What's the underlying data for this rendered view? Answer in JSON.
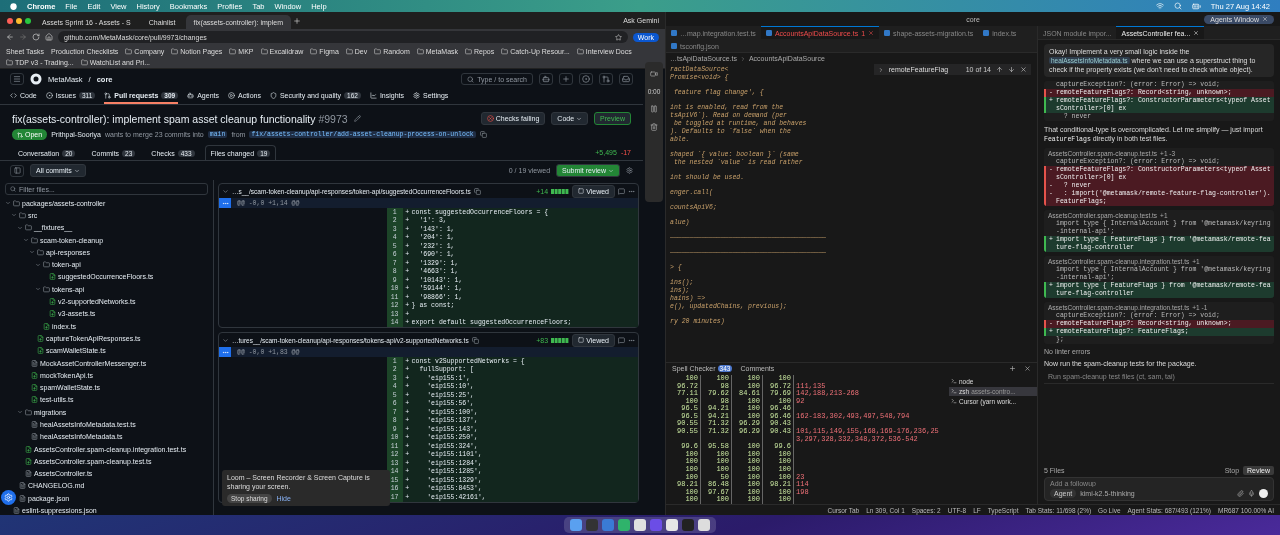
{
  "menubar": {
    "app": "Chrome",
    "items": [
      "File",
      "Edit",
      "View",
      "History",
      "Bookmarks",
      "Profiles",
      "Tab",
      "Window",
      "Help"
    ],
    "clock": "Thu 27 Aug  14:42"
  },
  "browser": {
    "tabs": [
      {
        "title": "Assets Sprint 16 - Assets - S",
        "selected": false
      },
      {
        "title": "Chainlist",
        "selected": false
      },
      {
        "title": "fix(assets-controller): implem",
        "selected": true
      }
    ],
    "ask": "Ask Gemini",
    "url": "github.com/MetaMask/core/pull/9973/changes",
    "profile": "Work",
    "bookmarks": [
      {
        "label": "Sheet Tasks",
        "kind": "link"
      },
      {
        "label": "Production Checklists",
        "kind": "link"
      },
      {
        "label": "Company",
        "kind": "folder"
      },
      {
        "label": "Notion Pages",
        "kind": "folder"
      },
      {
        "label": "MKP",
        "kind": "folder"
      },
      {
        "label": "Excalidraw",
        "kind": "folder"
      },
      {
        "label": "Figma",
        "kind": "folder"
      },
      {
        "label": "Dev",
        "kind": "folder"
      },
      {
        "label": "Random",
        "kind": "folder"
      },
      {
        "label": "MetaMask",
        "kind": "folder"
      },
      {
        "label": "Repos",
        "kind": "folder"
      },
      {
        "label": "Catch-Up Resour...",
        "kind": "folder"
      },
      {
        "label": "Interview Docs",
        "kind": "folder"
      },
      {
        "label": "TDP v3 - Trading...",
        "kind": "folder"
      },
      {
        "label": "WatchList and Pri...",
        "kind": "folder"
      }
    ],
    "owner": "MetaMask",
    "separator": "/",
    "repo": "core",
    "search": "Type / to search",
    "repo_nav": [
      {
        "label": "Code",
        "selected": false
      },
      {
        "label": "Issues",
        "count": "311",
        "selected": false
      },
      {
        "label": "Pull requests",
        "count": "309",
        "selected": true
      },
      {
        "label": "Agents",
        "selected": false
      },
      {
        "label": "Actions",
        "selected": false
      },
      {
        "label": "Security and quality",
        "count": "162",
        "selected": false
      },
      {
        "label": "Insights",
        "selected": false
      },
      {
        "label": "Settings",
        "selected": false
      }
    ],
    "pr": {
      "title": "fix(assets-controller): implement spam asset cleanup functionality",
      "number": "#9973",
      "checks": "Checks failing",
      "code": "Code",
      "preview": "Preview",
      "state": "Open",
      "author": "Prithpal-Sooriya",
      "merge_text": "wants to merge 23 commits into",
      "base": "main",
      "from": "from",
      "head": "fix/assets-controller/add-asset-cleanup-process-on-unlock",
      "tabs": [
        {
          "label": "Conversation",
          "count": "20",
          "selected": false
        },
        {
          "label": "Commits",
          "count": "23",
          "selected": false
        },
        {
          "label": "Checks",
          "count": "433",
          "selected": false
        },
        {
          "label": "Files changed",
          "count": "19",
          "selected": true
        }
      ],
      "additions": "+5,495",
      "deletions": "-17"
    },
    "review_bar": {
      "commits": "All commits",
      "viewed": "0 / 19 viewed",
      "submit": "Submit review"
    },
    "filter": "Filter files...",
    "tree": [
      {
        "name": "packages/assets-controller",
        "kind": "folder",
        "expanded": true,
        "children": [
          {
            "name": "src",
            "kind": "folder",
            "expanded": true,
            "children": [
              {
                "name": "__fixtures__",
                "kind": "folder",
                "expanded": true,
                "children": [
                  {
                    "name": "scam-token-cleanup",
                    "kind": "folder",
                    "expanded": true,
                    "children": [
                      {
                        "name": "api-responses",
                        "kind": "folder",
                        "expanded": true,
                        "children": [
                          {
                            "name": "token-api",
                            "kind": "folder",
                            "expanded": true,
                            "children": [
                              {
                                "name": "suggestedOccurrenceFloors.ts",
                                "kind": "added"
                              }
                            ]
                          },
                          {
                            "name": "tokens-api",
                            "kind": "folder",
                            "expanded": true,
                            "children": [
                              {
                                "name": "v2-supportedNetworks.ts",
                                "kind": "added"
                              },
                              {
                                "name": "v3-assets.ts",
                                "kind": "added"
                              }
                            ]
                          },
                          {
                            "name": "index.ts",
                            "kind": "added"
                          }
                        ]
                      },
                      {
                        "name": "captureTokenApiResponses.ts",
                        "kind": "added"
                      },
                      {
                        "name": "scamWalletState.ts",
                        "kind": "added"
                      }
                    ]
                  },
                  {
                    "name": "MockAssetControllerMessenger.ts",
                    "kind": "modified"
                  },
                  {
                    "name": "mockTokenApi.ts",
                    "kind": "added"
                  },
                  {
                    "name": "spamWalletState.ts",
                    "kind": "added"
                  },
                  {
                    "name": "test-utils.ts",
                    "kind": "added"
                  }
                ]
              },
              {
                "name": "migrations",
                "kind": "folder",
                "expanded": true,
                "children": [
                  {
                    "name": "healAssetsInfoMetadata.test.ts",
                    "kind": "modified"
                  },
                  {
                    "name": "healAssetsInfoMetadata.ts",
                    "kind": "modified"
                  }
                ]
              },
              {
                "name": "AssetsController.spam-cleanup.integration.test.ts",
                "kind": "added"
              },
              {
                "name": "AssetsController.spam-cleanup.test.ts",
                "kind": "added"
              },
              {
                "name": "AssetsController.ts",
                "kind": "modified"
              }
            ]
          },
          {
            "name": "CHANGELOG.md",
            "kind": "modified"
          },
          {
            "name": "package.json",
            "kind": "modified"
          }
        ]
      },
      {
        "name": "eslint-suppressions.json",
        "kind": "modified"
      }
    ],
    "diffs": [
      {
        "path": "…s__/scam-token-cleanup/api-responses/token-api/suggestedOccurrenceFloors.ts",
        "added": "+14",
        "hunk": "@@ -0,0 +1,14 @@",
        "viewed": "Viewed",
        "checked": false,
        "lines": [
          {
            "n": "1",
            "sign": "+",
            "code": "const suggestedOccurrenceFloors = {"
          },
          {
            "n": "2",
            "sign": "+",
            "code": "  '1': 3,"
          },
          {
            "n": "3",
            "sign": "+",
            "code": "  '143': 1,"
          },
          {
            "n": "4",
            "sign": "+",
            "code": "  '204': 1,"
          },
          {
            "n": "5",
            "sign": "+",
            "code": "  '232': 1,"
          },
          {
            "n": "6",
            "sign": "+",
            "code": "  '690': 1,"
          },
          {
            "n": "7",
            "sign": "+",
            "code": "  '1329': 1,"
          },
          {
            "n": "8",
            "sign": "+",
            "code": "  '4663': 1,"
          },
          {
            "n": "9",
            "sign": "+",
            "code": "  '10143': 1,"
          },
          {
            "n": "10",
            "sign": "+",
            "code": "  '59144': 1,"
          },
          {
            "n": "11",
            "sign": "+",
            "code": "  '98866': 1,"
          },
          {
            "n": "12",
            "sign": "+",
            "code": "} as const;"
          },
          {
            "n": "13",
            "sign": "+"
          },
          {
            "n": "14",
            "sign": "+",
            "code": "export default suggestedOccurrenceFloors;"
          }
        ]
      },
      {
        "path": "…tures__/scam-token-cleanup/api-responses/tokens-api/v2-supportedNetworks.ts",
        "added": "+83",
        "hunk": "@@ -0,0 +1,83 @@",
        "viewed": "Viewed",
        "checked": false,
        "lines": [
          {
            "n": "1",
            "sign": "+",
            "code": "const v2SupportedNetworks = {"
          },
          {
            "n": "2",
            "sign": "+",
            "code": "  fullSupport: ["
          },
          {
            "n": "3",
            "sign": "+",
            "code": "    'eip155:1',"
          },
          {
            "n": "4",
            "sign": "+",
            "code": "    'eip155:10',"
          },
          {
            "n": "5",
            "sign": "+",
            "code": "    'eip155:25',"
          },
          {
            "n": "6",
            "sign": "+",
            "code": "    'eip155:56',"
          },
          {
            "n": "7",
            "sign": "+",
            "code": "    'eip155:100',"
          },
          {
            "n": "8",
            "sign": "+",
            "code": "    'eip155:137',"
          },
          {
            "n": "9",
            "sign": "+",
            "code": "    'eip155:143',"
          },
          {
            "n": "10",
            "sign": "+",
            "code": "    'eip155:250',"
          },
          {
            "n": "11",
            "sign": "+",
            "code": "    'eip155:324',"
          },
          {
            "n": "12",
            "sign": "+",
            "code": "    'eip155:1101',"
          },
          {
            "n": "13",
            "sign": "+",
            "code": "    'eip155:1284',"
          },
          {
            "n": "14",
            "sign": "+",
            "code": "    'eip155:1285',"
          },
          {
            "n": "15",
            "sign": "+",
            "code": "    'eip155:1329',"
          },
          {
            "n": "16",
            "sign": "+",
            "code": "    'eip155:8453',"
          },
          {
            "n": "17",
            "sign": "+",
            "code": "    'eip155:42161',"
          }
        ]
      }
    ],
    "loom_timer": "0:00"
  },
  "editor": {
    "title": "core",
    "agents_button": "Agents Window",
    "tabs": [
      {
        "label": "…map.integration.test.ts",
        "selected": false
      },
      {
        "label": "AccountsApiDataSource.ts",
        "errors": "1",
        "selected": true
      },
      {
        "label": "shape-assets-migration.ts",
        "selected": false
      },
      {
        "label": "index.ts",
        "selected": false
      },
      {
        "label": "tsconfig.json",
        "selected": false
      }
    ],
    "breadcrumb": [
      "…tsApiDataSource.ts",
      "AccountsApiDataSource"
    ],
    "find": {
      "query": "remoteFeatureFlag",
      "count": "10 of 14"
    },
    "code_blocks": [
      [
        "ractDataSource<",
        "Promise<void> {"
      ],
      [
        " feature flag change', {"
      ],
      [
        "int is enabled, read from the",
        "tsApiV6`). Read on demand (per",
        " be toggled at runtime, and behaves",
        "). Defaults to `false` when the",
        "able."
      ],
      [
        "shaped `{ value: boolean }` (same",
        " the nested `value` is read rather"
      ],
      [
        "int should be used."
      ],
      [
        "enger.call("
      ],
      [
        "countsApiV6;"
      ],
      [
        "alue)"
      ],
      [
        "────────────────────────────────────────"
      ],
      [
        "────────────────────────────────────────"
      ],
      [
        "> {"
      ],
      [
        "ins();",
        "ins);",
        "hains) =>",
        "e(), updatedChains, previous);"
      ],
      [
        "ry 20 minutes)"
      ]
    ],
    "panel": {
      "tabs": [
        {
          "label": "Spell Checker",
          "badge": "343",
          "selected": false
        },
        {
          "label": "Comments",
          "selected": false
        }
      ],
      "rows": [
        [
          "100",
          "100",
          "100",
          "100"
        ],
        [
          "96.72",
          "98",
          "100",
          "96.72",
          "111,135"
        ],
        [
          "77.11",
          "79.62",
          "84.61",
          "79.69",
          "142,188,213-268"
        ],
        [
          "100",
          "98",
          "100",
          "100",
          "92"
        ],
        [
          "96.5",
          "94.21",
          "100",
          "96.46"
        ],
        [
          "96.5",
          "94.21",
          "100",
          "96.46",
          "162-183,302,493,497,548,794"
        ],
        [
          "90.55",
          "71.32",
          "96.29",
          "90.43"
        ],
        [
          "90.55",
          "71.32",
          "96.29",
          "90.43",
          "101,115,149,155,168,169-176,236,253,297,328,332,348,372,536-542"
        ],
        [
          "99.6",
          "95.58",
          "100",
          "99.6"
        ],
        [
          "100",
          "100",
          "100",
          "100"
        ],
        [
          "100",
          "100",
          "100",
          "100"
        ],
        [
          "100",
          "100",
          "100",
          "100"
        ],
        [
          "100",
          "50",
          "100",
          "100",
          "23"
        ],
        [
          "98.21",
          "86.48",
          "100",
          "98.21",
          "114"
        ],
        [
          "100",
          "97.67",
          "100",
          "100",
          "198"
        ],
        [
          "100",
          "100",
          "100",
          "100"
        ]
      ],
      "terminals": [
        {
          "name": "node",
          "selected": false
        },
        {
          "name": "zsh",
          "detail": "assets-contro...",
          "selected": true
        },
        {
          "name": "Cursor (yarn work...",
          "selected": false
        }
      ]
    },
    "status": [
      "Cursor Tab",
      "Ln 309, Col 1",
      "Spaces: 2",
      "UTF-8",
      "LF",
      "TypeScript",
      "Tab Stats: 11/698 (2%)",
      "Go Live",
      "Agent Stats: 687/493 (121%)",
      "MR687 100.00% AI"
    ]
  },
  "chat": {
    "tabs": [
      {
        "label": "JSON module impor...",
        "selected": false
      },
      {
        "label": "AssetsController fea...",
        "selected": true
      }
    ],
    "messages": [
      {
        "kind": "user",
        "before": "Okay! Implement a very small logic inside the",
        "chip": "healAssetsInfoMetadata.ts",
        "after": "where we can use a superstruct thing to check if the property exists (we don't need to check whole object)."
      },
      {
        "kind": "diff",
        "lines": [
          {
            "kind": "context",
            "code": "captureException?: (error: Error) => void;"
          },
          {
            "kind": "removed",
            "sign": "-",
            "code": "remoteFeatureFlags?: Record<string, unknown>;"
          },
          {
            "kind": "added",
            "sign": "+",
            "code": "remoteFeatureFlags?: ConstructorParameters<typeof AssetsController>[0] ex"
          },
          {
            "kind": "context",
            "code": "  ? never"
          }
        ]
      },
      {
        "kind": "text",
        "before": "That conditional-type is overcomplicated. Let me simplify — just import",
        "code": "FeatureFlags",
        "after": "directly in both test files."
      },
      {
        "kind": "diff",
        "file": "AssetsController.spam-cleanup.test.ts",
        "stat": "+1 -3",
        "lines": [
          {
            "kind": "context",
            "code": "captureException?: (error: Error) => void;"
          },
          {
            "kind": "removed",
            "sign": "-",
            "code": "remoteFeatureFlags?: ConstructorParameters<typeof AssetsController>[0] ex"
          },
          {
            "kind": "removed",
            "sign": "-",
            "code": "  ? never"
          },
          {
            "kind": "removed",
            "sign": "-",
            "code": "  : import('@metamask/remote-feature-flag-controller').FeatureFlags;"
          }
        ]
      },
      {
        "kind": "diff",
        "file": "AssetsController.spam-cleanup.test.ts",
        "stat": "+1",
        "lines": [
          {
            "kind": "context",
            "code": "import type { InternalAccount } from '@metamask/keyring-internal-api';"
          },
          {
            "kind": "added",
            "sign": "+",
            "code": "import type { FeatureFlags } from '@metamask/remote-feature-flag-controller"
          }
        ]
      },
      {
        "kind": "diff",
        "file": "AssetsController.spam-cleanup.integration.test.ts",
        "stat": "+1",
        "lines": [
          {
            "kind": "context",
            "code": "import type { InternalAccount } from '@metamask/keyring-internal-api';"
          },
          {
            "kind": "added",
            "sign": "+",
            "code": "import type { FeatureFlags } from '@metamask/remote-feature-flag-controller"
          }
        ]
      },
      {
        "kind": "diff",
        "file": "AssetsController.spam-cleanup.integration.test.ts",
        "stat": "+1 -1",
        "lines": [
          {
            "kind": "context",
            "code": "captureException?: (error: Error) => void;"
          },
          {
            "kind": "removed",
            "sign": "-",
            "code": "remoteFeatureFlags?: Record<string, unknown>;"
          },
          {
            "kind": "added",
            "sign": "+",
            "code": "remoteFeatureFlags?: FeatureFlags;"
          },
          {
            "kind": "context",
            "code": "};"
          }
        ]
      },
      {
        "kind": "note",
        "text": "No linter errors"
      },
      {
        "kind": "plain",
        "text": "Now run the spam-cleanup tests for the package."
      },
      {
        "kind": "tool",
        "text": "Run spam-cleanup test files (ct, sam, tai)"
      }
    ],
    "files": "5 Files",
    "stop": "Stop",
    "review": "Review",
    "placeholder": "Add a followup",
    "mode": "Agent",
    "model": "kimi-k2.5-thinking"
  },
  "toast": {
    "text": "Loom – Screen Recorder & Screen Capture is sharing your screen.",
    "stop": "Stop sharing",
    "hide": "Hide"
  }
}
